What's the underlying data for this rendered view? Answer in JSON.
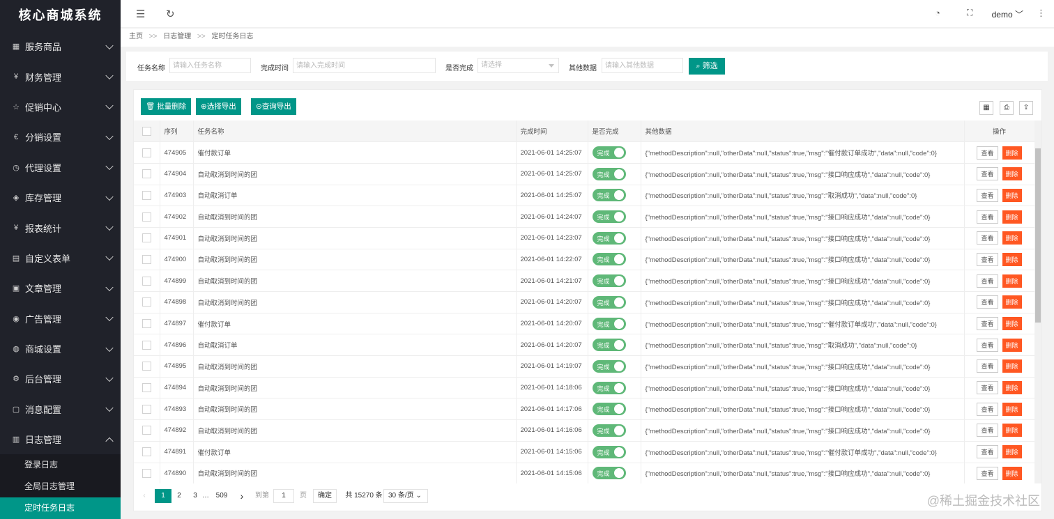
{
  "sidebar": {
    "logo": "核心商城系统",
    "items": [
      {
        "label": "服务商品",
        "icon": "grid-icon"
      },
      {
        "label": "财务管理",
        "icon": "yen-icon"
      },
      {
        "label": "促销中心",
        "icon": "star-icon"
      },
      {
        "label": "分销设置",
        "icon": "euro-icon"
      },
      {
        "label": "代理设置",
        "icon": "gauge-icon"
      },
      {
        "label": "库存管理",
        "icon": "stack-icon"
      },
      {
        "label": "报表统计",
        "icon": "yen-icon"
      },
      {
        "label": "自定义表单",
        "icon": "form-icon"
      },
      {
        "label": "文章管理",
        "icon": "file-icon"
      },
      {
        "label": "广告管理",
        "icon": "rss-icon"
      },
      {
        "label": "商城设置",
        "icon": "globe-icon"
      },
      {
        "label": "后台管理",
        "icon": "gear-icon"
      },
      {
        "label": "消息配置",
        "icon": "message-icon"
      },
      {
        "label": "日志管理",
        "icon": "log-icon"
      }
    ],
    "subitems": [
      "登录日志",
      "全局日志管理",
      "定时任务日志"
    ]
  },
  "header": {
    "user": "demo"
  },
  "breadcrumb": {
    "home": "主页",
    "sep": ">>",
    "level2": "日志管理",
    "level3": "定时任务日志"
  },
  "filter": {
    "name_label": "任务名称",
    "name_placeholder": "请输入任务名称",
    "time_label": "完成时间",
    "time_placeholder": "请输入完成时间",
    "done_label": "是否完成",
    "done_placeholder": "请选择",
    "other_label": "其他数据",
    "other_placeholder": "请输入其他数据",
    "search_btn": "筛选"
  },
  "toolbar": {
    "batch_delete": "批量删除",
    "export_selected": "选择导出",
    "export_query": "查询导出"
  },
  "table": {
    "headers": {
      "id": "序列",
      "name": "任务名称",
      "time": "完成时间",
      "done": "是否完成",
      "other": "其他数据",
      "ops": "操作"
    },
    "switch_label": "完成",
    "view_label": "查看",
    "delete_label": "删除",
    "rows": [
      {
        "id": "474905",
        "name": "催付款订单",
        "time": "2021-06-01 14:25:07",
        "other": "{\"methodDescription\":null,\"otherData\":null,\"status\":true,\"msg\":\"催付款订单成功\",\"data\":null,\"code\":0}"
      },
      {
        "id": "474904",
        "name": "自动取消到时间的团",
        "time": "2021-06-01 14:25:07",
        "other": "{\"methodDescription\":null,\"otherData\":null,\"status\":true,\"msg\":\"接口响应成功\",\"data\":null,\"code\":0}"
      },
      {
        "id": "474903",
        "name": "自动取消订单",
        "time": "2021-06-01 14:25:07",
        "other": "{\"methodDescription\":null,\"otherData\":null,\"status\":true,\"msg\":\"取消成功\",\"data\":null,\"code\":0}"
      },
      {
        "id": "474902",
        "name": "自动取消到时间的团",
        "time": "2021-06-01 14:24:07",
        "other": "{\"methodDescription\":null,\"otherData\":null,\"status\":true,\"msg\":\"接口响应成功\",\"data\":null,\"code\":0}"
      },
      {
        "id": "474901",
        "name": "自动取消到时间的团",
        "time": "2021-06-01 14:23:07",
        "other": "{\"methodDescription\":null,\"otherData\":null,\"status\":true,\"msg\":\"接口响应成功\",\"data\":null,\"code\":0}"
      },
      {
        "id": "474900",
        "name": "自动取消到时间的团",
        "time": "2021-06-01 14:22:07",
        "other": "{\"methodDescription\":null,\"otherData\":null,\"status\":true,\"msg\":\"接口响应成功\",\"data\":null,\"code\":0}"
      },
      {
        "id": "474899",
        "name": "自动取消到时间的团",
        "time": "2021-06-01 14:21:07",
        "other": "{\"methodDescription\":null,\"otherData\":null,\"status\":true,\"msg\":\"接口响应成功\",\"data\":null,\"code\":0}"
      },
      {
        "id": "474898",
        "name": "自动取消到时间的团",
        "time": "2021-06-01 14:20:07",
        "other": "{\"methodDescription\":null,\"otherData\":null,\"status\":true,\"msg\":\"接口响应成功\",\"data\":null,\"code\":0}"
      },
      {
        "id": "474897",
        "name": "催付款订单",
        "time": "2021-06-01 14:20:07",
        "other": "{\"methodDescription\":null,\"otherData\":null,\"status\":true,\"msg\":\"催付款订单成功\",\"data\":null,\"code\":0}"
      },
      {
        "id": "474896",
        "name": "自动取消订单",
        "time": "2021-06-01 14:20:07",
        "other": "{\"methodDescription\":null,\"otherData\":null,\"status\":true,\"msg\":\"取消成功\",\"data\":null,\"code\":0}"
      },
      {
        "id": "474895",
        "name": "自动取消到时间的团",
        "time": "2021-06-01 14:19:07",
        "other": "{\"methodDescription\":null,\"otherData\":null,\"status\":true,\"msg\":\"接口响应成功\",\"data\":null,\"code\":0}"
      },
      {
        "id": "474894",
        "name": "自动取消到时间的团",
        "time": "2021-06-01 14:18:06",
        "other": "{\"methodDescription\":null,\"otherData\":null,\"status\":true,\"msg\":\"接口响应成功\",\"data\":null,\"code\":0}"
      },
      {
        "id": "474893",
        "name": "自动取消到时间的团",
        "time": "2021-06-01 14:17:06",
        "other": "{\"methodDescription\":null,\"otherData\":null,\"status\":true,\"msg\":\"接口响应成功\",\"data\":null,\"code\":0}"
      },
      {
        "id": "474892",
        "name": "自动取消到时间的团",
        "time": "2021-06-01 14:16:06",
        "other": "{\"methodDescription\":null,\"otherData\":null,\"status\":true,\"msg\":\"接口响应成功\",\"data\":null,\"code\":0}"
      },
      {
        "id": "474891",
        "name": "催付款订单",
        "time": "2021-06-01 14:15:06",
        "other": "{\"methodDescription\":null,\"otherData\":null,\"status\":true,\"msg\":\"催付款订单成功\",\"data\":null,\"code\":0}"
      },
      {
        "id": "474890",
        "name": "自动取消到时间的团",
        "time": "2021-06-01 14:15:06",
        "other": "{\"methodDescription\":null,\"otherData\":null,\"status\":true,\"msg\":\"接口响应成功\",\"data\":null,\"code\":0}"
      }
    ]
  },
  "pager": {
    "current": "1",
    "p2": "2",
    "p3": "3",
    "ellipsis": "…",
    "last": "509",
    "goto_label": "到第",
    "goto_value": "1",
    "page_suffix": "页",
    "confirm": "确定",
    "total": "共 15270 条",
    "per_page": "30 条/页"
  },
  "watermark": "@稀土掘金技术社区",
  "colors": {
    "primary": "#009688",
    "sidebar_bg": "#20222a",
    "switch_on": "#5fb878",
    "danger": "#ff5722"
  }
}
